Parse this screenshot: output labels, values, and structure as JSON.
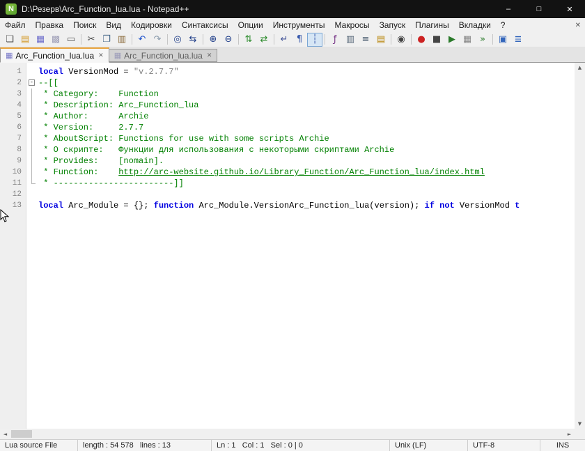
{
  "window": {
    "title": "D:\\Резерв\\Arc_Function_lua.lua - Notepad++",
    "logo_glyph": "N",
    "controls": {
      "minimize": "–",
      "maximize": "□",
      "close": "✕"
    }
  },
  "menu": {
    "items": [
      "Файл",
      "Правка",
      "Поиск",
      "Вид",
      "Кодировки",
      "Синтаксисы",
      "Опции",
      "Инструменты",
      "Макросы",
      "Запуск",
      "Плагины",
      "Вкладки",
      "?"
    ],
    "close_glyph": "✕"
  },
  "toolbar": {
    "buttons": [
      {
        "name": "new-file",
        "glyph": "❏",
        "color": "#4a4a4a"
      },
      {
        "name": "open-file",
        "glyph": "▤",
        "color": "#d49a2a"
      },
      {
        "name": "save-file",
        "glyph": "▦",
        "color": "#7070cc"
      },
      {
        "name": "save-all",
        "glyph": "▩",
        "color": "#a0a0b8"
      },
      {
        "name": "print",
        "glyph": "▭",
        "color": "#555555"
      },
      {
        "type": "separator"
      },
      {
        "name": "cut",
        "glyph": "✂",
        "color": "#444444"
      },
      {
        "name": "copy",
        "glyph": "❐",
        "color": "#446688"
      },
      {
        "name": "paste",
        "glyph": "▥",
        "color": "#8a6a3a"
      },
      {
        "type": "separator"
      },
      {
        "name": "undo",
        "glyph": "↶",
        "color": "#2255cc"
      },
      {
        "name": "redo",
        "glyph": "↷",
        "color": "#8899aa"
      },
      {
        "type": "separator"
      },
      {
        "name": "find",
        "glyph": "◎",
        "color": "#22408a"
      },
      {
        "name": "replace",
        "glyph": "⇆",
        "color": "#22408a"
      },
      {
        "type": "separator"
      },
      {
        "name": "zoom-in",
        "glyph": "⊕",
        "color": "#22408a"
      },
      {
        "name": "zoom-out",
        "glyph": "⊖",
        "color": "#22408a"
      },
      {
        "type": "separator"
      },
      {
        "name": "sync-vertical-scrolling",
        "glyph": "⇅",
        "color": "#2a8a2a"
      },
      {
        "name": "sync-horizontal-scrolling",
        "glyph": "⇄",
        "color": "#2a8a2a"
      },
      {
        "type": "separator"
      },
      {
        "name": "word-wrap",
        "glyph": "↵",
        "color": "#445599"
      },
      {
        "name": "show-all-characters",
        "glyph": "¶",
        "color": "#3355aa"
      },
      {
        "name": "show-indent-guide",
        "glyph": "┆",
        "color": "#3355aa",
        "active": true
      },
      {
        "type": "separator"
      },
      {
        "name": "function-list",
        "glyph": "ƒ",
        "color": "#7a3a8a"
      },
      {
        "name": "document-map",
        "glyph": "▥",
        "color": "#556677"
      },
      {
        "name": "document-list",
        "glyph": "≡",
        "color": "#556677"
      },
      {
        "name": "folder-as-workspace",
        "glyph": "▤",
        "color": "#b8860b"
      },
      {
        "type": "separator"
      },
      {
        "name": "monitoring",
        "glyph": "◉",
        "color": "#444444"
      },
      {
        "type": "separator"
      },
      {
        "name": "macro-record",
        "glyph": "●",
        "color": "#cc2222"
      },
      {
        "name": "macro-stop",
        "glyph": "■",
        "color": "#444444"
      },
      {
        "name": "macro-play",
        "glyph": "▶",
        "color": "#2a7a2a"
      },
      {
        "name": "macro-save",
        "glyph": "▦",
        "color": "#888888"
      },
      {
        "name": "macro-run-multiple",
        "glyph": "»",
        "color": "#2a7a2a"
      },
      {
        "type": "separator"
      },
      {
        "name": "plugin-document-switcher",
        "glyph": "▣",
        "color": "#3366bb"
      },
      {
        "name": "plugin-panel",
        "glyph": "≣",
        "color": "#3366bb"
      }
    ]
  },
  "tabbar": {
    "doc_icon_glyph": "▦",
    "close_glyph": "✕",
    "tabs": [
      {
        "label": "Arc_Function_lua.lua",
        "active": true
      },
      {
        "label": "Arc_Function_lua.lua",
        "active": false
      }
    ]
  },
  "editor": {
    "fold_minus_glyph": "-",
    "lines": [
      {
        "num": 1,
        "fold": "",
        "segments": [
          {
            "text": "local",
            "style": "keyword"
          },
          {
            "text": " VersionMod = ",
            "style": "plain"
          },
          {
            "text": "\"v.2.7.7\"",
            "style": "string"
          }
        ]
      },
      {
        "num": 2,
        "fold": "minus",
        "segments": [
          {
            "text": "--[[",
            "style": "comment"
          }
        ]
      },
      {
        "num": 3,
        "fold": "line",
        "segments": [
          {
            "text": " * Category:    Function",
            "style": "comment"
          }
        ]
      },
      {
        "num": 4,
        "fold": "line",
        "segments": [
          {
            "text": " * Description: Arc_Function_lua",
            "style": "comment"
          }
        ]
      },
      {
        "num": 5,
        "fold": "line",
        "segments": [
          {
            "text": " * Author:      Archie",
            "style": "comment"
          }
        ]
      },
      {
        "num": 6,
        "fold": "line",
        "segments": [
          {
            "text": " * Version:     2.7.7",
            "style": "comment"
          }
        ]
      },
      {
        "num": 7,
        "fold": "line",
        "segments": [
          {
            "text": " * AboutScript: Functions for use with some scripts Archie",
            "style": "comment"
          }
        ]
      },
      {
        "num": 8,
        "fold": "line",
        "segments": [
          {
            "text": " * О скрипте:   Функции для использования с некоторыми скриптами Archie",
            "style": "comment"
          }
        ]
      },
      {
        "num": 9,
        "fold": "line",
        "segments": [
          {
            "text": " * Provides:    [nomain].",
            "style": "comment"
          }
        ]
      },
      {
        "num": 10,
        "fold": "line",
        "segments": [
          {
            "text": " * Function:    ",
            "style": "comment"
          },
          {
            "text": "http://arc-website.github.io/Library_Function/Arc_Function_lua/index.html",
            "style": "link"
          }
        ]
      },
      {
        "num": 11,
        "fold": "end",
        "segments": [
          {
            "text": " * ------------------------]]",
            "style": "comment"
          }
        ]
      },
      {
        "num": 12,
        "fold": "",
        "segments": []
      },
      {
        "num": 13,
        "fold": "",
        "segments": [
          {
            "text": "local",
            "style": "keyword"
          },
          {
            "text": " Arc_Module = {}; ",
            "style": "plain"
          },
          {
            "text": "function",
            "style": "keyword"
          },
          {
            "text": " Arc_Module.VersionArc_Function_lua(version); ",
            "style": "plain"
          },
          {
            "text": "if",
            "style": "keyword"
          },
          {
            "text": " ",
            "style": "plain"
          },
          {
            "text": "not",
            "style": "keyword"
          },
          {
            "text": " VersionMod ",
            "style": "plain"
          },
          {
            "text": "t",
            "style": "keyword"
          }
        ]
      }
    ]
  },
  "scrollbar": {
    "left_arrow": "◄",
    "right_arrow": "►",
    "up_arrow": "▲",
    "down_arrow": "▼"
  },
  "statusbar": {
    "doc_type": "Lua source File",
    "length_lines": "length : 54 578   lines : 13",
    "position": "Ln : 1   Col : 1   Sel : 0 | 0",
    "eol": "Unix (LF)",
    "encoding": "UTF-8",
    "insert_mode": "INS"
  },
  "colors": {
    "keyword": "#0000e0",
    "comment": "#008000",
    "string": "#808080",
    "active_tab_accent": "#e8a33d",
    "titlebar_bg": "#121212"
  }
}
